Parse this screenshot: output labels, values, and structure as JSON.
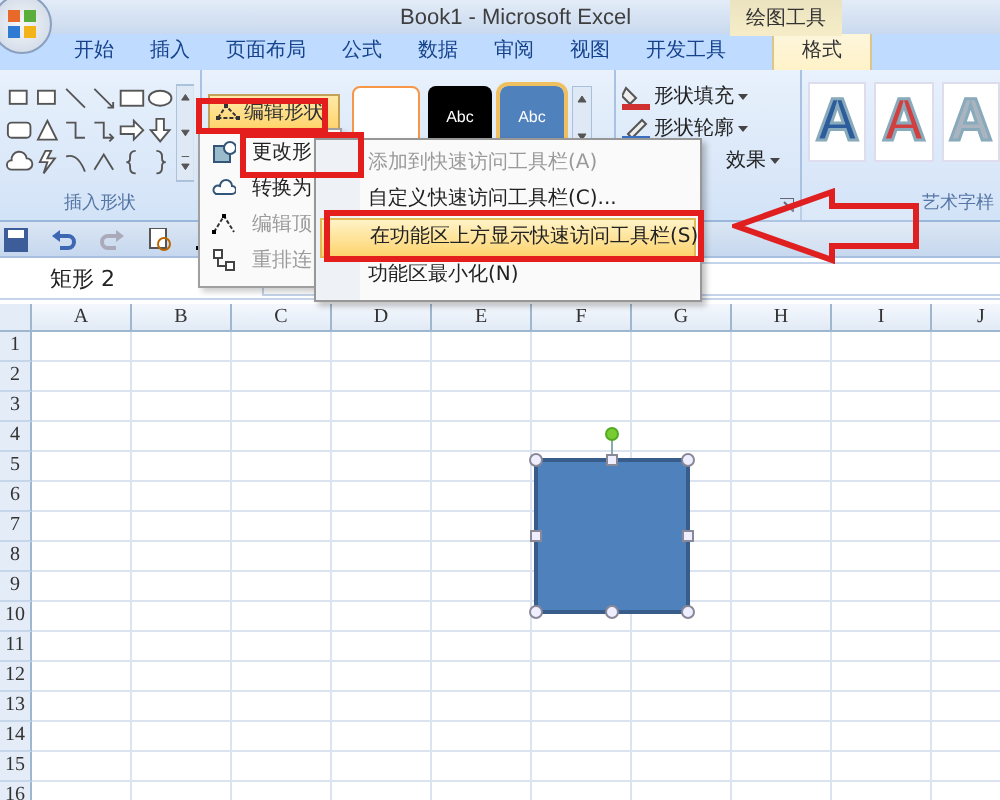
{
  "window": {
    "title": "Book1 - Microsoft Excel",
    "context_group": "绘图工具"
  },
  "tabs": [
    {
      "label": "开始",
      "selected": false
    },
    {
      "label": "插入",
      "selected": false
    },
    {
      "label": "页面布局",
      "selected": false
    },
    {
      "label": "公式",
      "selected": false
    },
    {
      "label": "数据",
      "selected": false
    },
    {
      "label": "审阅",
      "selected": false
    },
    {
      "label": "视图",
      "selected": false
    },
    {
      "label": "开发工具",
      "selected": false
    },
    {
      "label": "格式",
      "selected": true
    }
  ],
  "ribbon": {
    "insert_shapes_label": "插入形状",
    "edit_shape_button": "编辑形状",
    "style_samples": [
      "Abc",
      "Abc"
    ],
    "shape_commands": [
      "形状填充",
      "形状轮廓",
      "效果"
    ],
    "wordart_label": "艺术字样",
    "wordart_samples": [
      {
        "label": "A",
        "color": "#2d5c9c"
      },
      {
        "label": "A",
        "color": "#d04040"
      },
      {
        "label": "A",
        "color": "#aab4c0"
      }
    ]
  },
  "name_box": {
    "value": "矩形 2"
  },
  "edit_shape_menu": [
    {
      "label": "更改形",
      "disabled": false
    },
    {
      "label": "转换为",
      "disabled": false
    },
    {
      "label": "编辑顶",
      "disabled": true
    },
    {
      "label": "重排连",
      "disabled": true
    }
  ],
  "context_menu": [
    {
      "label": "添加到快速访问工具栏(A)",
      "disabled": true,
      "selected": false
    },
    {
      "label": "自定义快速访问工具栏(C)...",
      "disabled": false,
      "selected": false
    },
    {
      "label": "在功能区上方显示快速访问工具栏(S)",
      "disabled": false,
      "selected": true
    },
    {
      "label": "功能区最小化(N)",
      "disabled": false,
      "selected": false
    }
  ],
  "sheet": {
    "columns": [
      "A",
      "B",
      "C",
      "D",
      "E",
      "F",
      "G",
      "H",
      "I",
      "J"
    ],
    "rows": [
      "1",
      "2",
      "3",
      "4",
      "5",
      "6",
      "7",
      "8",
      "9",
      "10",
      "11",
      "12",
      "13",
      "14",
      "15",
      "16"
    ]
  }
}
